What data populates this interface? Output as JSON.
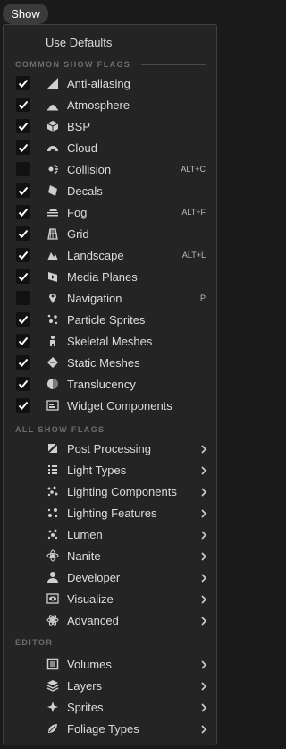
{
  "show_button": {
    "label": "Show"
  },
  "use_defaults_label": "Use Defaults",
  "sections": {
    "common": "COMMON SHOW FLAGS",
    "all": "ALL SHOW FLAGS",
    "editor": "EDITOR"
  },
  "common_flags": [
    {
      "label": "Anti-aliasing",
      "checked": true,
      "shortcut": "",
      "icon": "anti-aliasing-icon"
    },
    {
      "label": "Atmosphere",
      "checked": true,
      "shortcut": "",
      "icon": "atmosphere-icon"
    },
    {
      "label": "BSP",
      "checked": true,
      "shortcut": "",
      "icon": "bsp-icon"
    },
    {
      "label": "Cloud",
      "checked": true,
      "shortcut": "",
      "icon": "cloud-icon"
    },
    {
      "label": "Collision",
      "checked": false,
      "shortcut": "ALT+C",
      "icon": "collision-icon"
    },
    {
      "label": "Decals",
      "checked": true,
      "shortcut": "",
      "icon": "decals-icon"
    },
    {
      "label": "Fog",
      "checked": true,
      "shortcut": "ALT+F",
      "icon": "fog-icon"
    },
    {
      "label": "Grid",
      "checked": true,
      "shortcut": "",
      "icon": "grid-icon"
    },
    {
      "label": "Landscape",
      "checked": true,
      "shortcut": "ALT+L",
      "icon": "landscape-icon"
    },
    {
      "label": "Media Planes",
      "checked": true,
      "shortcut": "",
      "icon": "media-planes-icon"
    },
    {
      "label": "Navigation",
      "checked": false,
      "shortcut": "P",
      "icon": "navigation-icon"
    },
    {
      "label": "Particle Sprites",
      "checked": true,
      "shortcut": "",
      "icon": "particle-sprites-icon"
    },
    {
      "label": "Skeletal Meshes",
      "checked": true,
      "shortcut": "",
      "icon": "skeletal-meshes-icon"
    },
    {
      "label": "Static Meshes",
      "checked": true,
      "shortcut": "",
      "icon": "static-meshes-icon"
    },
    {
      "label": "Translucency",
      "checked": true,
      "shortcut": "",
      "icon": "translucency-icon"
    },
    {
      "label": "Widget Components",
      "checked": true,
      "shortcut": "",
      "icon": "widget-components-icon"
    }
  ],
  "all_flags": [
    {
      "label": "Post Processing",
      "icon": "post-processing-icon"
    },
    {
      "label": "Light Types",
      "icon": "light-types-icon"
    },
    {
      "label": "Lighting Components",
      "icon": "lighting-components-icon"
    },
    {
      "label": "Lighting Features",
      "icon": "lighting-features-icon"
    },
    {
      "label": "Lumen",
      "icon": "lumen-icon"
    },
    {
      "label": "Nanite",
      "icon": "nanite-icon"
    },
    {
      "label": "Developer",
      "icon": "developer-icon"
    },
    {
      "label": "Visualize",
      "icon": "visualize-icon"
    },
    {
      "label": "Advanced",
      "icon": "advanced-icon"
    }
  ],
  "editor_items": [
    {
      "label": "Volumes",
      "icon": "volumes-icon"
    },
    {
      "label": "Layers",
      "icon": "layers-icon"
    },
    {
      "label": "Sprites",
      "icon": "sprites-icon"
    },
    {
      "label": "Foliage Types",
      "icon": "foliage-types-icon"
    }
  ],
  "colors": {
    "menu_bg": "#242424",
    "page_bg": "#1a1a1a",
    "text": "#dcdcdc",
    "section_text": "#6e6e6e",
    "checkbox_bg": "#111111",
    "check": "#ffffff"
  }
}
